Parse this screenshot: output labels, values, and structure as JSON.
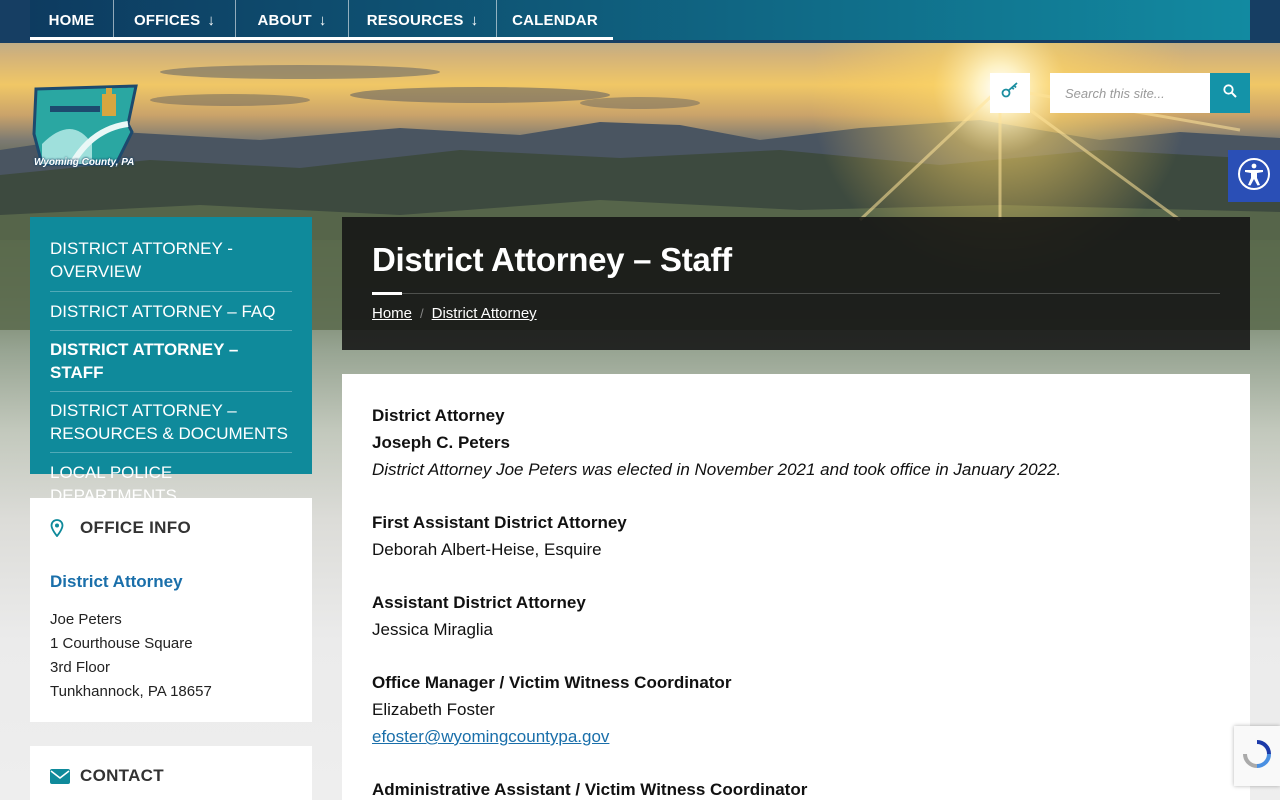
{
  "nav": {
    "items": [
      {
        "label": "HOME",
        "has_dropdown": false
      },
      {
        "label": "OFFICES",
        "has_dropdown": true
      },
      {
        "label": "ABOUT",
        "has_dropdown": true
      },
      {
        "label": "RESOURCES",
        "has_dropdown": true
      },
      {
        "label": "CALENDAR",
        "has_dropdown": false
      }
    ],
    "dropdown_arrow": "↓"
  },
  "logo": {
    "alt_text": "Wyoming County, PA",
    "badge_text": "Wyoming County, PA"
  },
  "search": {
    "placeholder": "Search this site..."
  },
  "icons": {
    "key": "key-icon",
    "search": "search-icon",
    "accessibility": "accessibility-icon",
    "map_pin": "map-pin-icon",
    "envelope": "envelope-icon"
  },
  "colors": {
    "nav_start": "#0d3b60",
    "nav_end": "#128aa1",
    "teal": "#0f8a9b",
    "link": "#1a6faa",
    "accessibility": "#2a4fb6"
  },
  "sidebar": {
    "menu": [
      {
        "label": "DISTRICT ATTORNEY - OVERVIEW",
        "active": false
      },
      {
        "label": "DISTRICT ATTORNEY – FAQ",
        "active": false
      },
      {
        "label": "DISTRICT ATTORNEY – STAFF",
        "active": true
      },
      {
        "label": "DISTRICT ATTORNEY – RESOURCES & DOCUMENTS",
        "active": false
      },
      {
        "label": "LOCAL POLICE DEPARTMENTS",
        "active": false
      }
    ],
    "office_info": {
      "heading": "OFFICE INFO",
      "office_name": "District Attorney",
      "address_lines": [
        "Joe Peters",
        "1 Courthouse Square",
        "3rd Floor",
        "Tunkhannock, PA 18657"
      ]
    },
    "contact": {
      "heading": "CONTACT"
    }
  },
  "banner": {
    "title": "District Attorney – Staff",
    "breadcrumb": {
      "home": "Home",
      "separator": "/",
      "current": "District Attorney"
    }
  },
  "content": {
    "da_role": "District Attorney",
    "da_name": "Joseph C. Peters",
    "da_note": "District Attorney Joe Peters was elected in November 2021 and took office in January 2022.",
    "first_asst_role": "First Assistant District Attorney",
    "first_asst_name": "Deborah Albert-Heise, Esquire",
    "asst_role": "Assistant District Attorney",
    "asst_name": "Jessica Miraglia",
    "office_mgr_role": "Office Manager / Victim Witness Coordinator",
    "office_mgr_name": "Elizabeth Foster",
    "office_mgr_email": "efoster@wyomingcountypa.gov",
    "admin_role": "Administrative Assistant / Victim Witness Coordinator"
  }
}
